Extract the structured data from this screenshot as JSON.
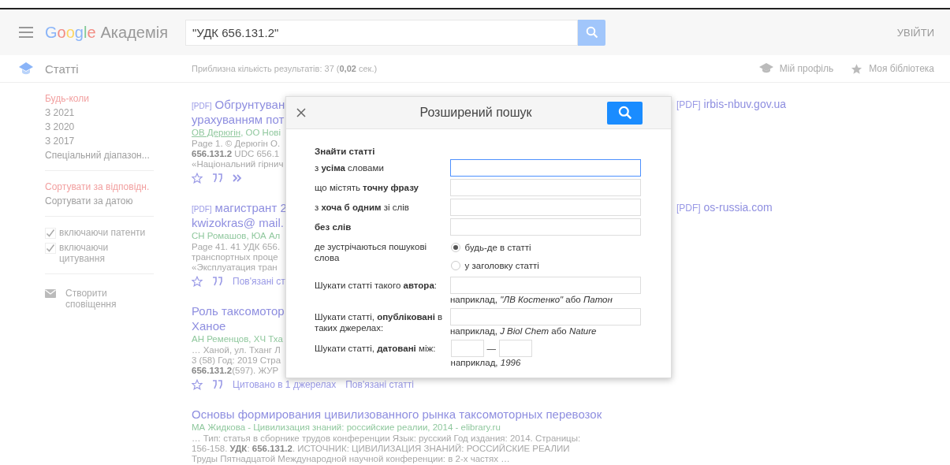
{
  "header": {
    "logo_google": "Google",
    "logo_product": "Академія",
    "search": {
      "value": "\"УДК 656.131.2\""
    },
    "sign_in": "УВІЙТИ"
  },
  "subbar": {
    "section": "Статті",
    "stats": "Приблизна кількість результатів: 37 (**0,02** сек.)",
    "profile": "Мій профіль",
    "library": "Моя бібліотека"
  },
  "sidebar": {
    "time_filters": [
      {
        "label": "Будь-коли",
        "selected": true
      },
      {
        "label": "З 2021",
        "selected": false
      },
      {
        "label": "З 2020",
        "selected": false
      },
      {
        "label": "З 2017",
        "selected": false
      },
      {
        "label": "Спеціальний діапазон...",
        "selected": false
      }
    ],
    "sort": [
      {
        "label": "Сортувати за відповідн.",
        "selected": true
      },
      {
        "label": "Сортувати за датою",
        "selected": false
      }
    ],
    "options": [
      {
        "label": "включаючи патенти",
        "checked": true
      },
      {
        "label": "включаючи цитування",
        "checked": true
      }
    ],
    "alert": "Створити сповіщення"
  },
  "results": [
    {
      "tag": "[PDF]",
      "title_lines": [
        "Обгрунтуван",
        "урахуванням пот"
      ],
      "authors": [
        {
          "text": "ОВ Дерюгін",
          "underlined": true
        },
        {
          "text": ", ОО Нові",
          "underlined": false
        }
      ],
      "snippet_lines": [
        "Page 1. © Дерюгін О.",
        "**656.131.2** UDC 656.1",
        "«Національний гірнич"
      ],
      "actions": [
        {
          "kind": "star"
        },
        {
          "kind": "cite"
        },
        {
          "kind": "more"
        }
      ],
      "side_link": {
        "tag": "[PDF]",
        "label": "irbis-nbuv.gov.ua"
      }
    },
    {
      "tag": "[PDF]",
      "title_lines": [
        "магистрант 2",
        "kwizokras@ mail."
      ],
      "authors": [
        {
          "text": "СН Ромашов, ЮА Ал",
          "underlined": false
        }
      ],
      "snippet_lines": [
        "Page 41. 41 УДК 656.",
        "транспортных проце",
        "«Эксплуатация тран"
      ],
      "actions": [
        {
          "kind": "star"
        },
        {
          "kind": "cite"
        },
        {
          "kind": "link",
          "label": "Пов'язані ст"
        }
      ],
      "side_link": {
        "tag": "[PDF]",
        "label": "os-russia.com"
      }
    },
    {
      "title_lines": [
        "Роль таксомотор",
        "Ханое"
      ],
      "authors": [
        {
          "text": "АН Ременцов, ХЧ Тха",
          "underlined": false
        }
      ],
      "snippet_lines": [
        "… Ханой, ул. Тханг Л",
        "3 (58) Год: 2019 Стра",
        "**656.131.2**(597). ЖУР"
      ],
      "actions": [
        {
          "kind": "star"
        },
        {
          "kind": "cite"
        },
        {
          "kind": "link",
          "label": "Цитовано в 1 джерелах"
        },
        {
          "kind": "link",
          "label": "Пов'язані статті"
        }
      ]
    },
    {
      "title_lines": [
        "Основы формирования цивилизованного рынка таксомоторных перевозок"
      ],
      "authors": [
        {
          "text": "МА Жидкова - Цивилизация знаний: российские реалии, 2014 - elibrary.ru",
          "underlined": false
        }
      ],
      "snippet_lines": [
        "… Тип: статья в сборнике трудов конференции Язык: русский Год издания: 2014. Страницы:",
        "156-158. **УДК**: **656.131.2**. ИСТОЧНИК: ЦИВИЛИЗАЦИЯ ЗНАНИЙ: РОССИЙСКИЕ РЕАЛИИ",
        "Труды Пятнадцатой Международной научной конференции: в 2-х частях …"
      ]
    }
  ],
  "dialog": {
    "title": "Розширений пошук",
    "heading": "Знайти статті",
    "rows": [
      {
        "kind": "text",
        "label": "з **усіма** словами",
        "focused": true
      },
      {
        "kind": "text",
        "label": "що містять **точну фразу**",
        "focused": false
      },
      {
        "kind": "text",
        "label": "з **хоча б одним** зі слів",
        "focused": false
      },
      {
        "kind": "text",
        "label": "**без слів**",
        "focused": false
      },
      {
        "kind": "radio",
        "label": "де зустрічаються пошукові слова",
        "options": [
          {
            "label": "будь-де в статті",
            "selected": true
          },
          {
            "label": "у заголовку статті",
            "selected": false
          }
        ]
      },
      {
        "kind": "text",
        "label": "Шукати статті такого **автора**:",
        "hint": "наприклад, *\"ЛВ Костенко\"* або *Патон*",
        "focused": false
      },
      {
        "kind": "text",
        "label": "Шукати статті, **опубліковані** в таких джерелах:",
        "hint": "наприклад, *J Biol Chem* або *Nature*",
        "focused": false
      },
      {
        "kind": "range",
        "label": "Шукати статті, **датовані** між:",
        "separator": "—",
        "hint": "наприклад, *1996*"
      }
    ]
  }
}
